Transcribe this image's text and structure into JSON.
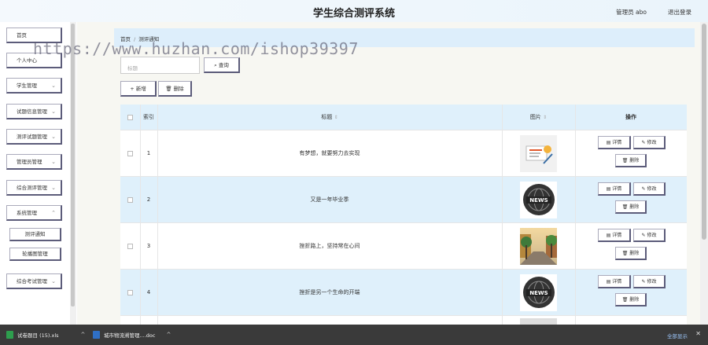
{
  "header": {
    "title": "学生综合测评系统",
    "user": "管理员 abo",
    "logout": "退出登录"
  },
  "sidebar": {
    "items": [
      {
        "label": "首页",
        "chevron": false
      },
      {
        "label": "个人中心",
        "chevron": false
      },
      {
        "label": "学生管理",
        "chevron": true
      },
      {
        "label": "试题信息管理",
        "chevron": true
      },
      {
        "label": "测评试题管理",
        "chevron": true
      },
      {
        "label": "管理员管理",
        "chevron": true
      },
      {
        "label": "综合测评管理",
        "chevron": true
      },
      {
        "label": "系统管理",
        "chevron": true
      }
    ],
    "subitems": [
      {
        "label": "测评通知"
      },
      {
        "label": "轮播图管理"
      }
    ],
    "last": {
      "label": "综合考试管理",
      "chevron": true
    },
    "chevron_glyph": "⌄"
  },
  "breadcrumb": {
    "home": "首页",
    "sep": "/",
    "current": "测评通知"
  },
  "search": {
    "placeholder": "标题",
    "button": "查询",
    "icon": "search-icon"
  },
  "toolbar": {
    "add": "新增",
    "delete": "删除"
  },
  "watermark": "https://www.huzhan.com/ishop39397",
  "table": {
    "headers": {
      "index": "索引",
      "title": "标题",
      "image": "图片",
      "actions": "操作"
    },
    "sort_glyph": "⇕",
    "rows": [
      {
        "index": "1",
        "title": "有梦想，就要努力去实现",
        "image": "document-icon"
      },
      {
        "index": "2",
        "title": "又是一年毕业季",
        "image": "news-icon"
      },
      {
        "index": "3",
        "title": "挫折路上，坚持常在心间",
        "image": "street-photo"
      },
      {
        "index": "4",
        "title": "挫折是另一个生命的开端",
        "image": "news-icon"
      }
    ],
    "actions": {
      "detail": "详情",
      "edit": "修改",
      "delete": "删除"
    },
    "news_text": "NEWS"
  },
  "taskbar": {
    "files": [
      {
        "name": "试卷题目 (15).xls"
      },
      {
        "name": "城市物流溯管理....doc"
      }
    ],
    "show_all": "全部显示",
    "close": "✕"
  }
}
